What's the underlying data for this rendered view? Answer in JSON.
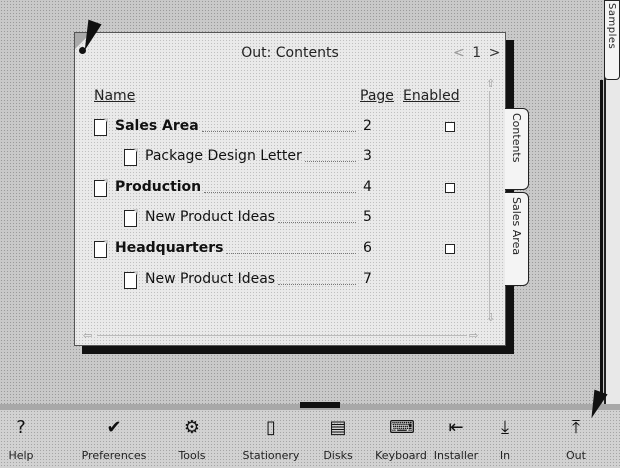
{
  "window": {
    "title": "Out: Contents",
    "page_nav_left": "<",
    "page_number": "1",
    "page_nav_right": ">"
  },
  "right_panel": {
    "tab_label": "Samples"
  },
  "columns": {
    "name": "Name",
    "page": "Page",
    "enabled": "Enabled"
  },
  "rows": [
    {
      "name": "Sales Area",
      "page": "2",
      "level": 0,
      "bold": true,
      "enabled_checkbox": true
    },
    {
      "name": "Package Design Letter",
      "page": "3",
      "level": 1,
      "bold": false,
      "enabled_checkbox": false
    },
    {
      "name": "Production",
      "page": "4",
      "level": 0,
      "bold": true,
      "enabled_checkbox": true
    },
    {
      "name": "New Product Ideas",
      "page": "5",
      "level": 1,
      "bold": false,
      "enabled_checkbox": false
    },
    {
      "name": "Headquarters",
      "page": "6",
      "level": 0,
      "bold": true,
      "enabled_checkbox": true
    },
    {
      "name": "New Product Ideas",
      "page": "7",
      "level": 1,
      "bold": false,
      "enabled_checkbox": false
    }
  ],
  "side_tabs": [
    {
      "label": "Contents"
    },
    {
      "label": "Sales Area"
    }
  ],
  "dock": [
    {
      "label": "Help",
      "icon": "help-icon"
    },
    {
      "label": "Preferences",
      "icon": "checkmark-icon"
    },
    {
      "label": "Tools",
      "icon": "tools-icon"
    },
    {
      "label": "Stationery",
      "icon": "stationery-icon"
    },
    {
      "label": "Disks",
      "icon": "disk-icon"
    },
    {
      "label": "Keyboard",
      "icon": "keyboard-icon"
    },
    {
      "label": "Installer",
      "icon": "installer-icon"
    },
    {
      "label": "In",
      "icon": "in-tray-icon"
    },
    {
      "label": "Out",
      "icon": "out-tray-icon"
    }
  ]
}
